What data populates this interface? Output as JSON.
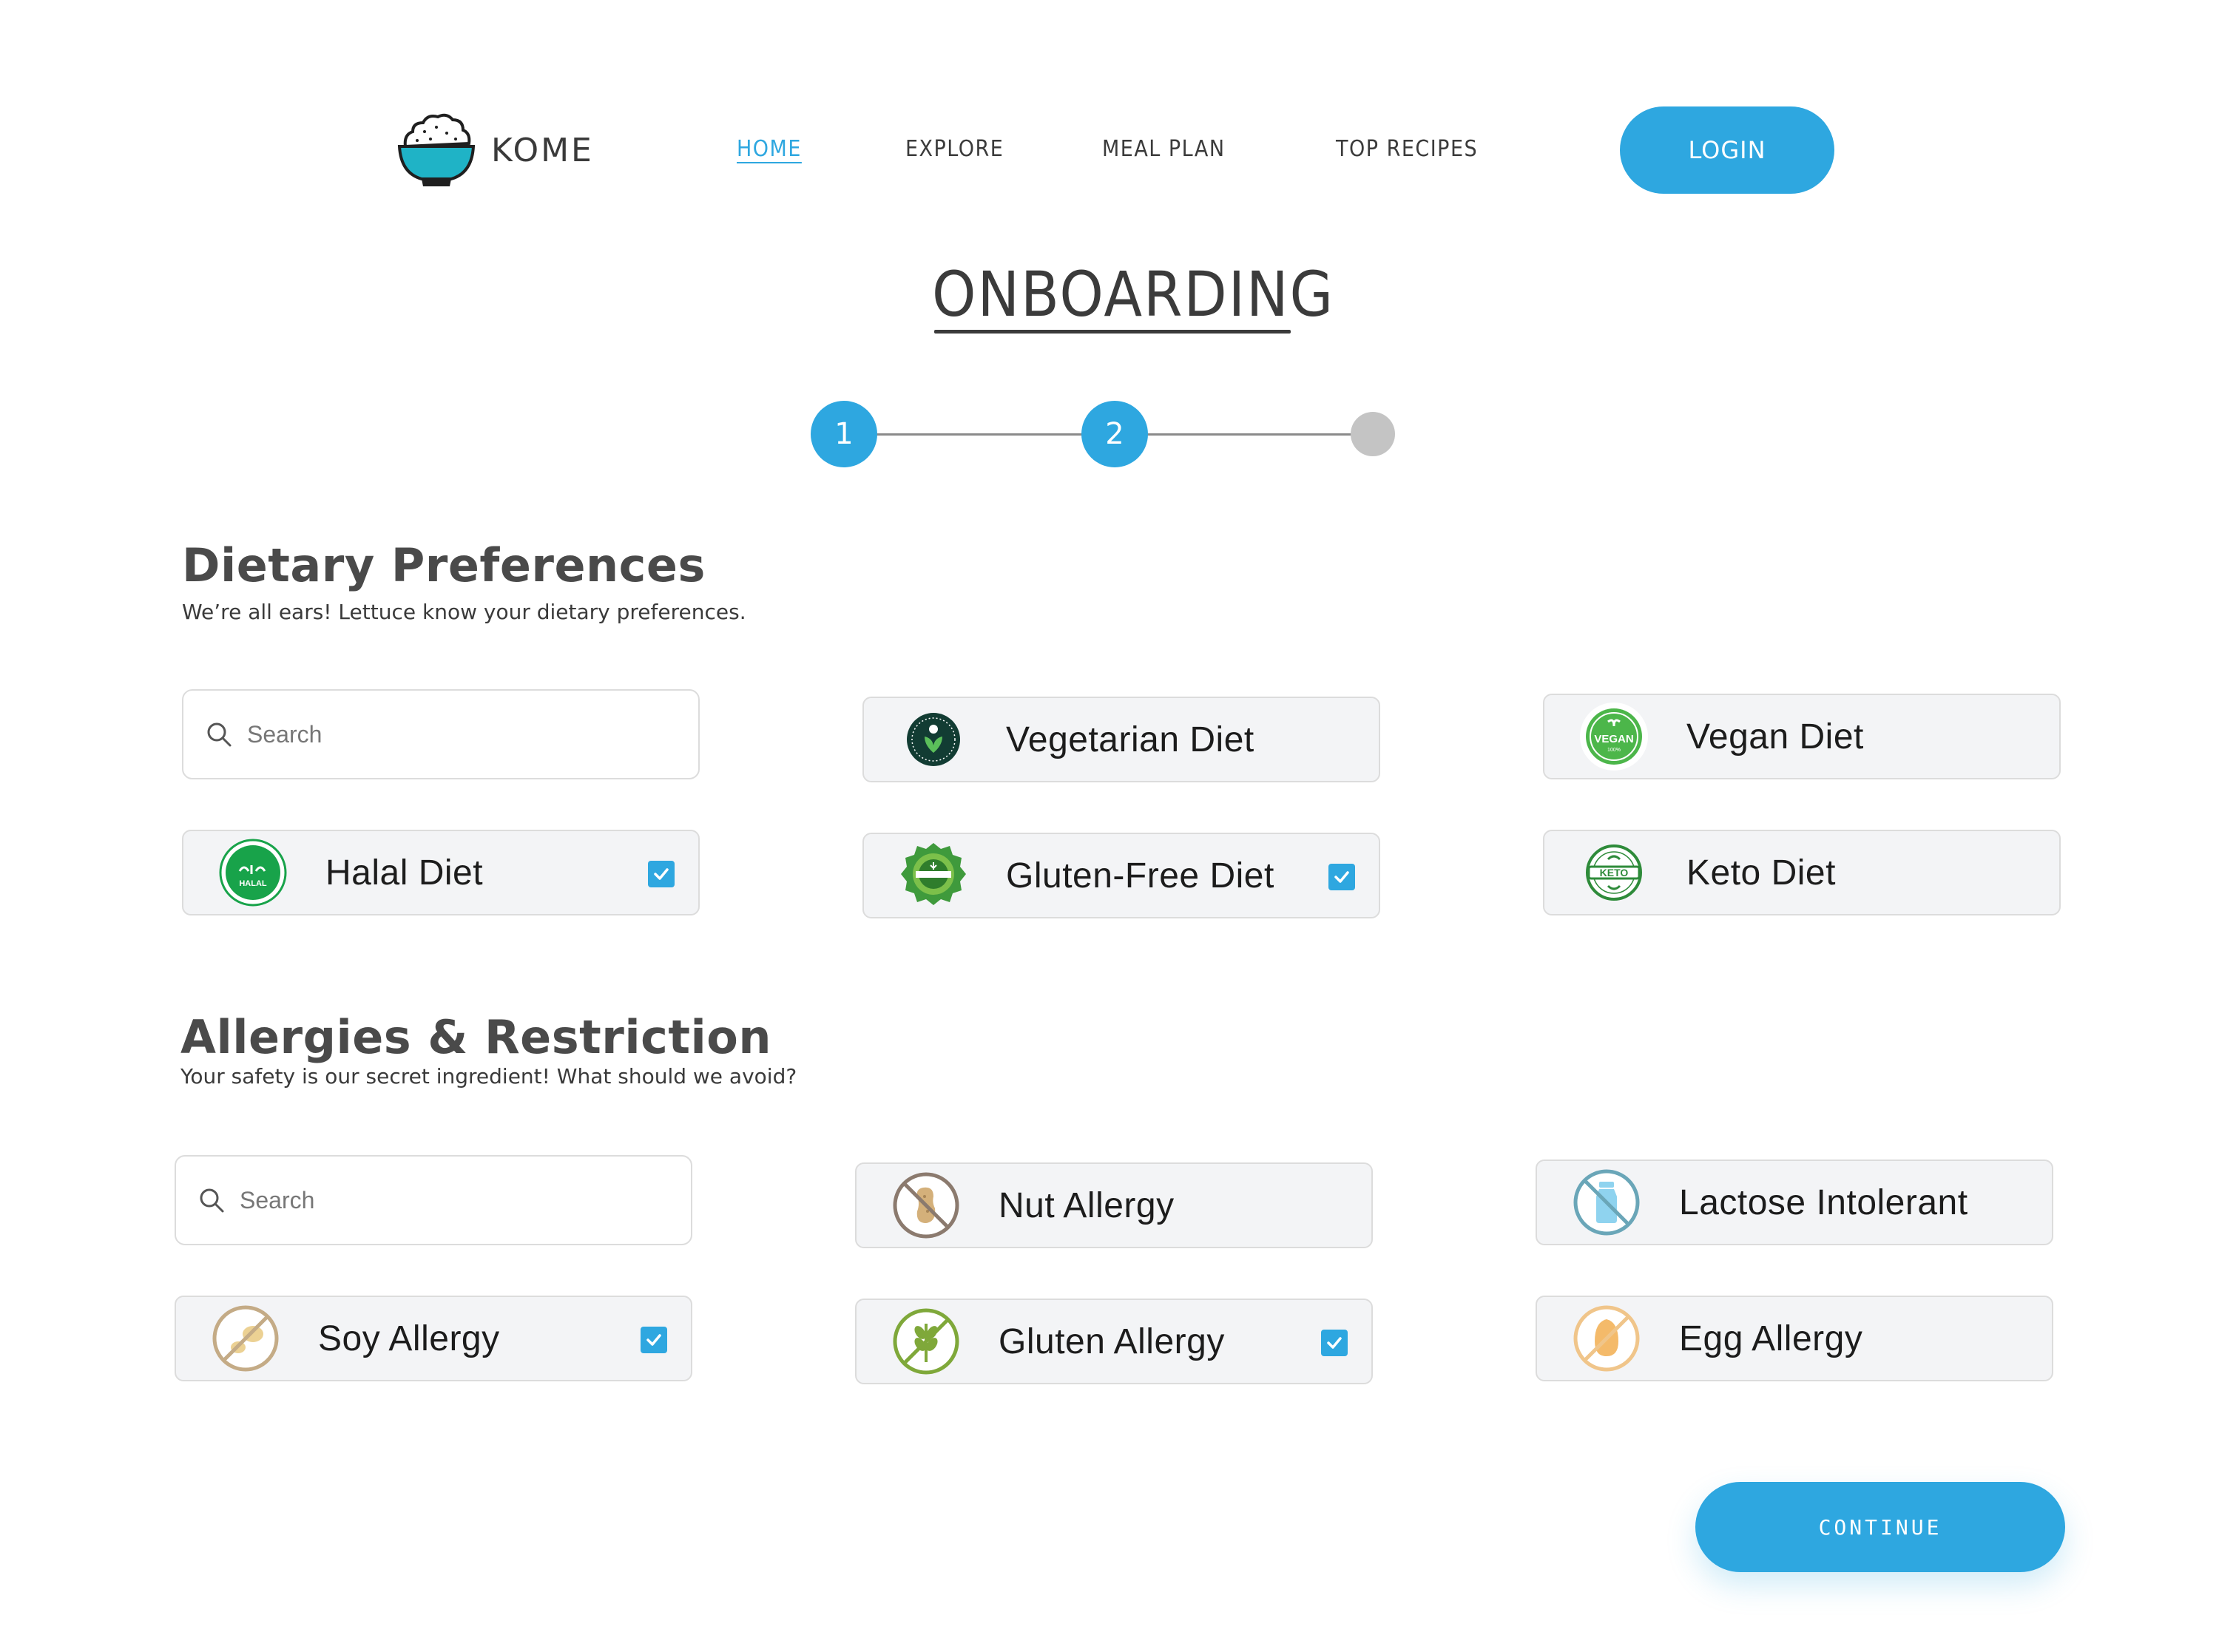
{
  "header": {
    "logo_text": "KOME",
    "nav": [
      {
        "label": "HOME",
        "active": true
      },
      {
        "label": "EXPLORE",
        "active": false
      },
      {
        "label": "MEAL PLAN",
        "active": false
      },
      {
        "label": "TOP RECIPES",
        "active": false
      }
    ],
    "login_label": "LOGIN"
  },
  "page_title": "ONBOARDING",
  "stepper": {
    "steps": [
      "1",
      "2",
      ""
    ],
    "current_step": 2,
    "total_steps": 3
  },
  "dietary": {
    "title": "Dietary Preferences",
    "subtitle": "We’re all ears! Lettuce know your dietary preferences.",
    "search_placeholder": "Search",
    "options": [
      {
        "label": "Vegetarian Diet",
        "icon": "vegetarian-badge-icon",
        "checked": false
      },
      {
        "label": "Vegan Diet",
        "icon": "vegan-badge-icon",
        "checked": false
      },
      {
        "label": "Halal Diet",
        "icon": "halal-badge-icon",
        "checked": true
      },
      {
        "label": "Gluten-Free Diet",
        "icon": "gluten-free-badge-icon",
        "checked": true
      },
      {
        "label": "Keto Diet",
        "icon": "keto-badge-icon",
        "checked": false
      }
    ]
  },
  "allergies": {
    "title": "Allergies & Restriction",
    "subtitle": "Your safety is our secret ingredient! What should we avoid?",
    "search_placeholder": "Search",
    "options": [
      {
        "label": "Nut Allergy",
        "icon": "no-nut-icon",
        "checked": false
      },
      {
        "label": "Lactose Intolerant",
        "icon": "no-milk-icon",
        "checked": false
      },
      {
        "label": "Soy Allergy",
        "icon": "no-soy-icon",
        "checked": true
      },
      {
        "label": "Gluten Allergy",
        "icon": "no-wheat-icon",
        "checked": true
      },
      {
        "label": "Egg Allergy",
        "icon": "no-egg-icon",
        "checked": false
      }
    ]
  },
  "continue_label": "CONTINUE",
  "colors": {
    "accent": "#2ea7e0",
    "step_pending": "#c4c4c4",
    "card_bg": "#f3f4f6"
  }
}
